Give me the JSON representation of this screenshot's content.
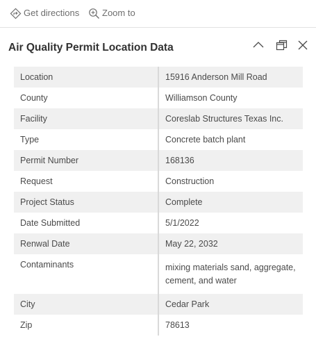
{
  "toolbar": {
    "directions_label": "Get directions",
    "zoom_label": "Zoom to"
  },
  "header": {
    "title": "Air Quality Permit Location Data"
  },
  "rows": [
    {
      "key": "Location",
      "value": "15916 Anderson Mill Road"
    },
    {
      "key": "County",
      "value": "Williamson County"
    },
    {
      "key": "Facility",
      "value": "Coreslab Structures Texas Inc."
    },
    {
      "key": "Type",
      "value": "Concrete batch plant"
    },
    {
      "key": "Permit Number",
      "value": "168136"
    },
    {
      "key": "Request",
      "value": "Construction"
    },
    {
      "key": "Project Status",
      "value": "Complete"
    },
    {
      "key": "Date Submitted",
      "value": "5/1/2022"
    },
    {
      "key": "Renwal Date",
      "value": "May 22, 2032"
    },
    {
      "key": "Contaminants",
      "value": "mixing materials sand, aggregate, cement, and water"
    },
    {
      "key": "City",
      "value": "Cedar Park"
    },
    {
      "key": "Zip",
      "value": "78613"
    }
  ],
  "icons": {
    "directions": "directions-icon",
    "zoom": "zoom-in-icon",
    "collapse": "chevron-up-icon",
    "dock": "dock-icon",
    "close": "close-icon"
  },
  "colors": {
    "row_odd": "#f0f0f0",
    "row_even": "#ffffff",
    "text": "#4a4a4a",
    "title": "#323232"
  }
}
